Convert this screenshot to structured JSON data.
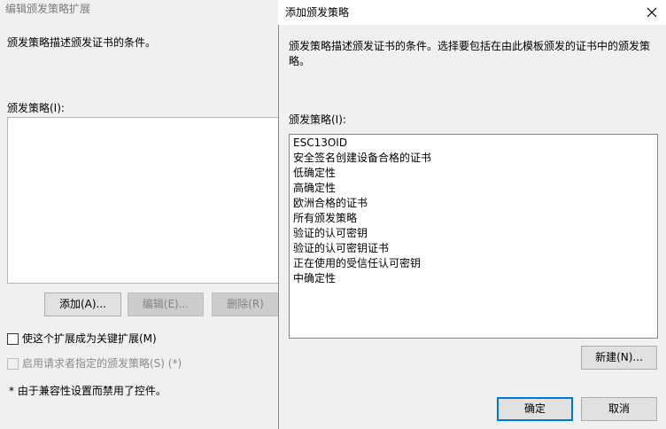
{
  "background_dialog": {
    "title": "编辑颁发策略扩展",
    "description": "颁发策略描述颁发证书的条件。",
    "policies_label": "颁发策略(I):",
    "add_button": "添加(A)...",
    "edit_button": "编辑(E)...",
    "remove_button": "删除(R)",
    "critical_checkbox_label": "使这个扩展成为关键扩展(M)",
    "requester_checkbox_label": "启用请求者指定的颁发策略(S) (*)",
    "compat_note": "* 由于兼容性设置而禁用了控件。"
  },
  "add_dialog": {
    "title": "添加颁发策略",
    "description_line1": "颁发策略描述颁发证书的条件。选择要包括在由此模板颁发的证书中的颁发策",
    "description_line2": "略。",
    "policies_label": "颁发策略(I):",
    "policies": [
      "ESC13OID",
      "安全签名创建设备合格的证书",
      "低确定性",
      "高确定性",
      "欧洲合格的证书",
      "所有颁发策略",
      "验证的认可密钥",
      "验证的认可密钥证书",
      "正在使用的受信任认可密钥",
      "中确定性"
    ],
    "new_button": "新建(N)...",
    "ok_button": "确定",
    "cancel_button": "取消"
  },
  "icons": {
    "close": "close-icon"
  }
}
